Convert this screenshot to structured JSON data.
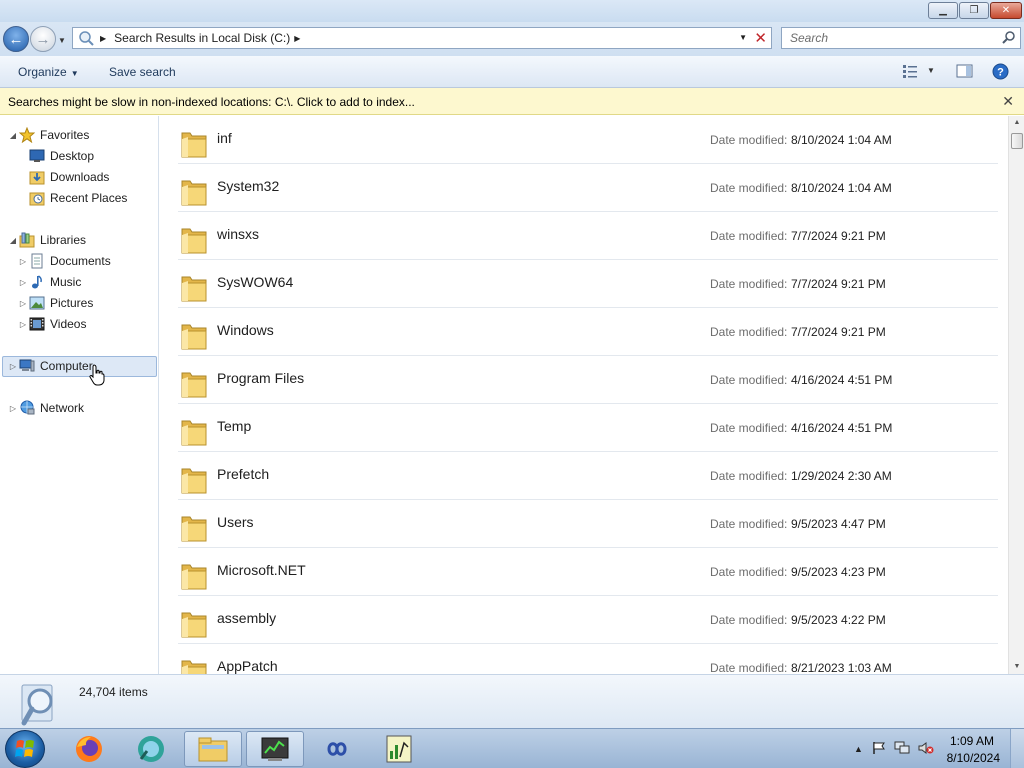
{
  "window": {
    "minimize_icon": "minimize-icon",
    "maximize_icon": "restore-icon",
    "close_icon": "close-icon"
  },
  "address": {
    "path_label": "Search Results in Local Disk (C:)",
    "icon": "search-folder-icon"
  },
  "search": {
    "placeholder": "Search"
  },
  "commandbar": {
    "organize": "Organize",
    "save_search": "Save search"
  },
  "infobar": {
    "message": "Searches might be slow in non-indexed locations: C:\\. Click to add to index..."
  },
  "nav": {
    "favorites": "Favorites",
    "desktop": "Desktop",
    "downloads": "Downloads",
    "recent_places": "Recent Places",
    "libraries": "Libraries",
    "documents": "Documents",
    "music": "Music",
    "pictures": "Pictures",
    "videos": "Videos",
    "computer": "Computer",
    "network": "Network"
  },
  "files": {
    "date_label": "Date modified:",
    "items": [
      {
        "name": "inf",
        "date": "8/10/2024 1:04 AM"
      },
      {
        "name": "System32",
        "date": "8/10/2024 1:04 AM"
      },
      {
        "name": "winsxs",
        "date": "7/7/2024 9:21 PM"
      },
      {
        "name": "SysWOW64",
        "date": "7/7/2024 9:21 PM"
      },
      {
        "name": "Windows",
        "date": "7/7/2024 9:21 PM"
      },
      {
        "name": "Program Files",
        "date": "4/16/2024 4:51 PM"
      },
      {
        "name": "Temp",
        "date": "4/16/2024 4:51 PM"
      },
      {
        "name": "Prefetch",
        "date": "1/29/2024 2:30 AM"
      },
      {
        "name": "Users",
        "date": "9/5/2023 4:47 PM"
      },
      {
        "name": "Microsoft.NET",
        "date": "9/5/2023 4:23 PM"
      },
      {
        "name": "assembly",
        "date": "9/5/2023 4:22 PM"
      },
      {
        "name": "AppPatch",
        "date": "8/21/2023 1:03 AM"
      }
    ]
  },
  "details": {
    "item_count": "24,704 items"
  },
  "taskbar": {
    "apps": [
      "firefox-icon",
      "app-icon",
      "explorer-icon",
      "task-manager-icon",
      "infinity-icon",
      "chart-app-icon"
    ],
    "time": "1:09 AM",
    "date": "8/10/2024"
  },
  "colors": {
    "accent": "#1e395b",
    "infobar_bg": "#fdf8cf",
    "selection": "#dde8f6"
  }
}
